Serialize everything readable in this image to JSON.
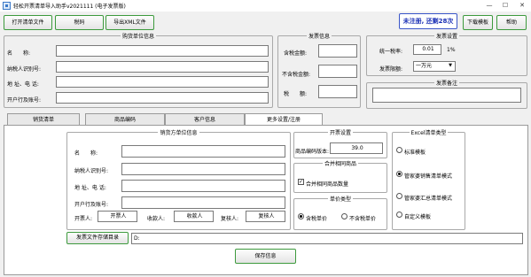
{
  "window": {
    "title": "轻松开票清单导入助手v2021111 (电子发票版)",
    "controls": {
      "minimize": "—",
      "maximize": "☐",
      "close": "✕"
    }
  },
  "toolbar": {
    "open_list": "打开清单文件",
    "tax_code": "税码",
    "export_xml": "导出XML文件",
    "register_status": "未注册, 还剩28次",
    "download_template": "下载模板",
    "help": "帮助"
  },
  "buyer": {
    "legend": "购货单位信息",
    "name_label": "名　　称:",
    "taxid_label": "纳税人识别号:",
    "address_label": "地 址、电 话:",
    "bank_label": "开户行及账号:"
  },
  "invoice_info": {
    "legend": "发票信息",
    "incl_tax_label": "含税金额:",
    "excl_tax_label": "不含税金额:",
    "tax_label": "税　　额:"
  },
  "invoice_settings": {
    "legend": "发票设置",
    "tax_rate_label": "统一税率:",
    "tax_rate_value": "0.01",
    "tax_rate_unit": "1%",
    "limit_label": "发票限额:",
    "limit_value": "一万元"
  },
  "invoice_remark": {
    "legend": "发票备注"
  },
  "tabs": [
    {
      "label": "销货清单"
    },
    {
      "label": "商品编码"
    },
    {
      "label": "客户信息"
    },
    {
      "label": "更多设置/注册"
    }
  ],
  "seller": {
    "legend": "销货方单位信息",
    "name_label": "名　　称:",
    "taxid_label": "纳税人识别号:",
    "address_label": "地 址、电 话:",
    "bank_label": "开户行及账号:",
    "drawer_label": "开票人:",
    "drawer_value": "开票人",
    "payee_label": "收款人:",
    "payee_value": "收款人",
    "reviewer_label": "复核人:",
    "reviewer_value": "复核人"
  },
  "issue_settings": {
    "legend": "开票设置",
    "version_label": "商品编码版本:",
    "version_value": "39.0"
  },
  "merge": {
    "legend": "合并相同商品",
    "qty_label": "合并相同商品数量",
    "qty_checked": true
  },
  "price_type": {
    "legend": "单价类型",
    "with_tax": "含税单价",
    "without_tax": "不含税单价"
  },
  "excel_type": {
    "legend": "Excel清单类型",
    "options": [
      "标准模板",
      "管家婆销售清单模式",
      "管家婆汇总清单模式",
      "自定义模板"
    ]
  },
  "footer": {
    "storage_button": "发票文件存储目录",
    "storage_path": "D:",
    "save_button": "保存信息"
  },
  "colors": {
    "accent_border": "#3d9a3d",
    "register_text": "#1a2fb5"
  }
}
